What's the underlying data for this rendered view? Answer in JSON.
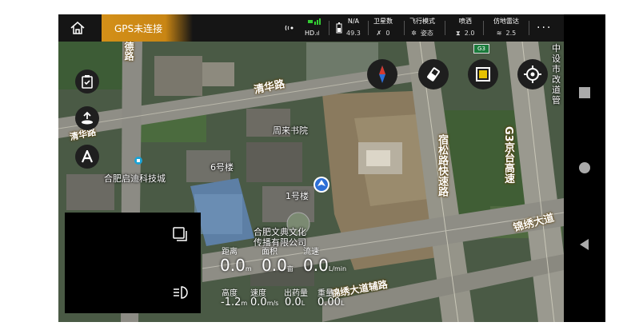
{
  "topbar": {
    "gps_status": "GPS未连接",
    "signal_label": "HD",
    "signal_small": ".ıl",
    "battery_top": "N/A",
    "battery_value": "49.3",
    "satellites_label": "卫星数",
    "satellites_value": "0",
    "flight_mode_label": "飞行模式",
    "flight_mode_value": "姿态",
    "spray_label": "喷洒",
    "spray_value": "2.0",
    "radar_label": "仿地雷达",
    "radar_value": "2.5",
    "more": "···"
  },
  "map": {
    "places": {
      "zhoulai": "周来书院",
      "building6": "6号楼",
      "building1": "1号楼",
      "qidi": "合肥启迪科技城",
      "wendian": "合肥文典文化",
      "wendian2": "传播有限公司",
      "right_edge": "中设市改道管"
    },
    "roads": {
      "qinghua": "清华路",
      "qinghua2": "清华路",
      "de": "德路",
      "susong": "宿松路快速路",
      "g3": "G3京台高速",
      "jinxiu": "锦绣大道",
      "jinxiu_fu": "锦绣大道辅路",
      "badge": "G3"
    }
  },
  "telemetry": {
    "distance_label": "距离",
    "area_label": "面积",
    "flow_label": "流速",
    "distance_value": "0.0",
    "distance_unit": "m",
    "area_value": "0.0",
    "area_unit": "亩",
    "flow_value": "0.0",
    "flow_unit": "L/min",
    "height_label": "高度",
    "speed_label": "速度",
    "dose_label": "出药量",
    "weight_label": "重量",
    "height_value": "-1.2",
    "height_unit": "m",
    "speed_value": "0.0",
    "speed_unit": "m/s",
    "dose_value": "0.0",
    "dose_unit": "L",
    "weight_value": "0.00",
    "weight_unit": "L"
  },
  "colors": {
    "accent": "#d38f18",
    "topbar": "#151515",
    "map": "#3c4a3b"
  }
}
